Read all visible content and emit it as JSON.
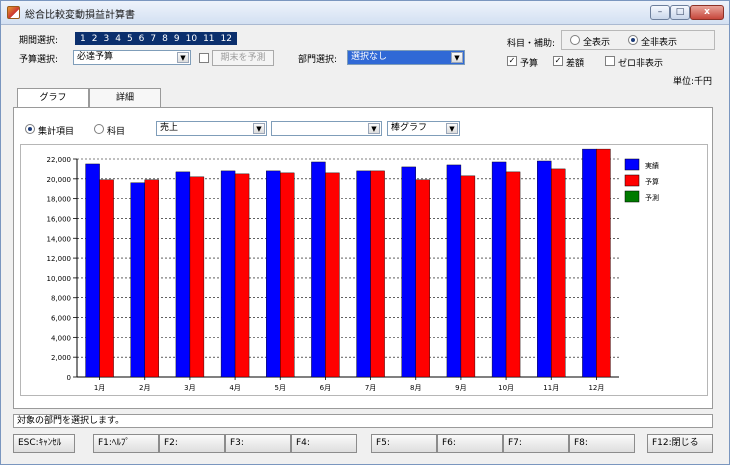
{
  "window": {
    "title": "総合比較変動損益計算書",
    "min_glyph": "–",
    "max_glyph": "□",
    "close_glyph": "x"
  },
  "period": {
    "label": "期間選択:",
    "months": [
      "1",
      "2",
      "3",
      "4",
      "5",
      "6",
      "7",
      "8",
      "9",
      "10",
      "11",
      "12"
    ]
  },
  "budget": {
    "label": "予算選択:",
    "value": "必達予算",
    "forecast_button": "期末を予測"
  },
  "department": {
    "label": "部門選択:",
    "value": "選択なし"
  },
  "account_aux": {
    "label": "科目・補助:",
    "options": [
      "全表示",
      "全非表示"
    ],
    "selected": "全非表示"
  },
  "checks": {
    "budget": {
      "label": "予算",
      "checked": true
    },
    "diff": {
      "label": "差額",
      "checked": true
    },
    "zero_hide": {
      "label": "ゼロ非表示",
      "checked": false
    }
  },
  "unit_label": "単位:千円",
  "tabs": [
    "グラフ",
    "詳細"
  ],
  "filters": {
    "radio_options": [
      "集計項目",
      "科目"
    ],
    "radio_selected": "集計項目",
    "item_value": "売上",
    "sub_value": "",
    "chart_type_value": "棒グラフ"
  },
  "colors": {
    "actual": "#0000ff",
    "budget": "#ff0000",
    "forecast": "#007a00"
  },
  "chart_data": {
    "type": "bar",
    "categories": [
      "1月",
      "2月",
      "3月",
      "4月",
      "5月",
      "6月",
      "7月",
      "8月",
      "9月",
      "10月",
      "11月",
      "12月"
    ],
    "series": [
      {
        "name": "実績",
        "values": [
          21500,
          19600,
          20700,
          20800,
          20800,
          21700,
          20800,
          21200,
          21400,
          21700,
          21800,
          23000
        ]
      },
      {
        "name": "予算",
        "values": [
          19900,
          19900,
          20200,
          20500,
          20600,
          20600,
          20800,
          19900,
          20300,
          20700,
          21000,
          23000
        ]
      },
      {
        "name": "予測",
        "values": [
          0,
          0,
          0,
          0,
          0,
          0,
          0,
          0,
          0,
          0,
          0,
          0
        ]
      }
    ],
    "y_ticks": [
      "0",
      "2,000",
      "4,000",
      "6,000",
      "8,000",
      "10,000",
      "12,000",
      "14,000",
      "16,000",
      "18,000",
      "20,000",
      "22,000"
    ],
    "ylim": [
      0,
      22000
    ],
    "grid": true,
    "legend": "top-right"
  },
  "status_text": "対象の部門を選択します。",
  "function_keys": [
    "ESC:ｷｬﾝｾﾙ",
    "F1:ﾍﾙﾌﾟ",
    "F2:",
    "F3:",
    "F4:",
    "F5:",
    "F6:",
    "F7:",
    "F8:",
    "F12:閉じる"
  ]
}
